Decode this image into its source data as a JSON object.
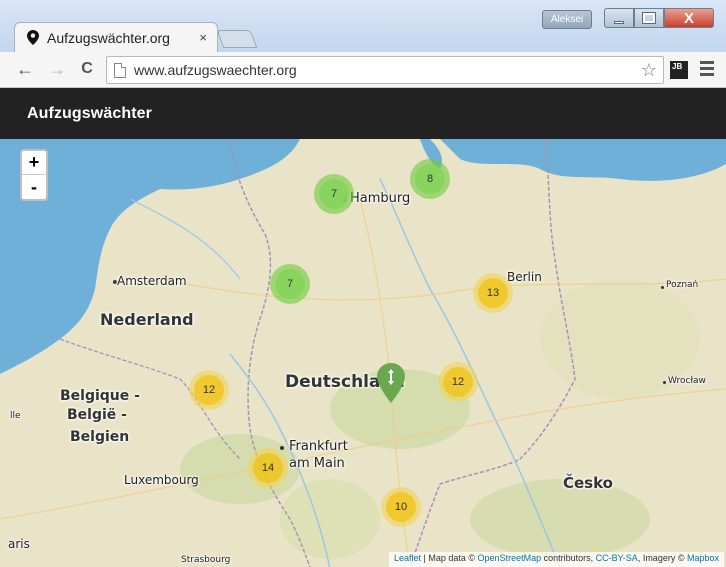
{
  "browser": {
    "tab_title": "Aufzugswächter.org",
    "tab_close": "×",
    "user_badge": "Aleksei",
    "close_glyph": "X",
    "url": "www.aufzugswaechter.org",
    "back_glyph": "←",
    "forward_glyph": "→",
    "reload_glyph": "C",
    "star_glyph": "☆",
    "extension_label": "JB"
  },
  "app": {
    "title": "Aufzugswächter"
  },
  "map": {
    "zoom_in": "+",
    "zoom_out": "-",
    "places": {
      "hamburg": "Hamburg",
      "amsterdam": "Amsterdam",
      "nederland": "Nederland",
      "berlin": "Berlin",
      "poznan": "Poznań",
      "deutschland": "Deutschland",
      "wroclaw": "Wrocław",
      "belgique_1": "Belgique -",
      "belgique_2": "België -",
      "belgique_3": "Belgien",
      "lille": "lle",
      "frankfurt_1": "Frankfurt",
      "frankfurt_2": "am Main",
      "luxembourg": "Luxembourg",
      "cesko": "Česko",
      "paris": "aris",
      "strasbourg": "Strasbourg"
    },
    "clusters": {
      "hamburg_west": "7",
      "hamburg_east": "8",
      "muenster": "7",
      "berlin": "13",
      "koeln": "12",
      "leipzig": "12",
      "frankfurt": "14",
      "nuernberg": "10"
    },
    "attribution": {
      "leaflet": "Leaflet",
      "sep": " | Map data © ",
      "osm": "OpenStreetMap",
      "contributors": " contributors, ",
      "license": "CC-BY-SA",
      "imagery": ", Imagery © ",
      "mapbox": "Mapbox"
    }
  },
  "colors": {
    "header_bg": "#222222",
    "water": "#6fb0d8",
    "land": "#e9e4c8",
    "forest": "#cfd9a6",
    "cluster_small": "#85d45a",
    "cluster_medium": "#f0c20c",
    "marker": "#6aa84f"
  }
}
